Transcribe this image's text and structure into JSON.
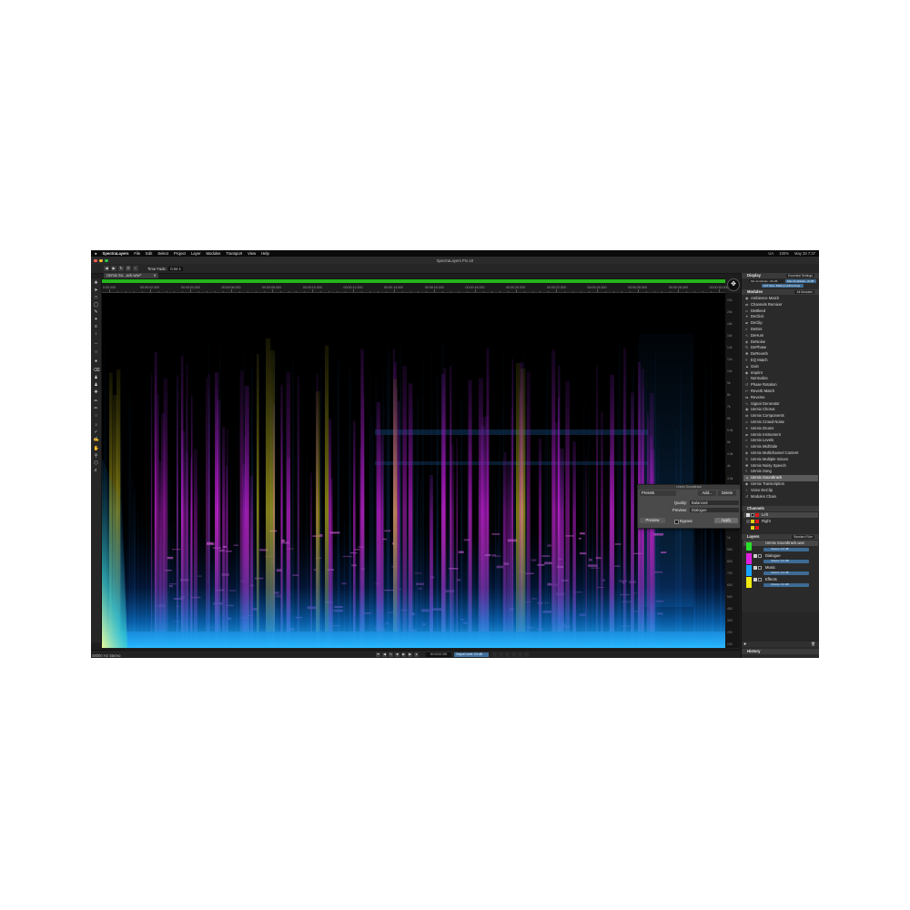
{
  "menubar": {
    "apple": "",
    "app_name": "SpectraLayers",
    "items": [
      "File",
      "Edit",
      "Select",
      "Project",
      "Layer",
      "Modules",
      "Transport",
      "View",
      "Help"
    ],
    "status": [
      "UA",
      "100%",
      "May 28  7:37"
    ]
  },
  "window": {
    "title": "SpectraLayers Pro 10"
  },
  "toolbar": {
    "time_fade_label": "Time Fade:",
    "time_fade_value": "0.04 s"
  },
  "tabs": [
    {
      "label": "Unmix So...ack.wav*"
    }
  ],
  "ruler": {
    "labels": [
      "0:00.000",
      "00:00:02.000",
      "00:00:04.000",
      "00:00:06.000",
      "00:00:08.000",
      "00:00:10.000",
      "00:00:12.000",
      "00:00:14.000",
      "00:00:16.000",
      "00:00:18.000",
      "00:00:20.000",
      "00:00:22.000",
      "00:00:24.000",
      "00:00:26.000",
      "00:00:28.000",
      "00:00:30.000"
    ]
  },
  "freq_axis": {
    "labels": [
      "22k",
      "20k",
      "18k",
      "16k",
      "14k",
      "12k",
      "10k",
      "9k",
      "8k",
      "7k",
      "6k",
      "5.5k",
      "5k",
      "4.5k",
      "4k",
      "3.5k",
      "3k",
      "2.5k",
      "2k",
      "1.5k",
      "1k",
      "900",
      "800",
      "700",
      "600",
      "500",
      "400",
      "300",
      "200",
      "100"
    ]
  },
  "statusbar": {
    "format": "48000 Hz Stereo",
    "timecode": "00:00:00.000",
    "output_level": "Output Level: 0.0 dB"
  },
  "display_panel": {
    "title": "Display",
    "preset": "Essential Settings",
    "controls": [
      "Min Amplitude: -96 dB",
      "Max Amplitude: +6 dB",
      "FFT Size: 8192 px (Ultra Fine)"
    ]
  },
  "modules_panel": {
    "title": "Modules",
    "filter": "All Modules",
    "items": [
      "Ambience Match",
      "Channels Remixer",
      "DeBleed",
      "DeClick",
      "DeClip",
      "DeEss",
      "DeHum",
      "DeNoise",
      "DePhase",
      "DeReverb",
      "EQ Match",
      "Gain",
      "Imprint",
      "Normalize",
      "Phase Rotation",
      "Reverb Match",
      "Reverse",
      "Signal Generator",
      "Unmix Chorus",
      "Unmix Components",
      "Unmix Crowd Noise",
      "Unmix Drums",
      "Unmix Instrument",
      "Unmix Levels",
      "Unmix Mid/Side",
      "Unmix Multichannel Content",
      "Unmix Multiple Voices",
      "Unmix Noisy Speech",
      "Unmix Song",
      "Unmix Soundtrack",
      "Unmix Transcription",
      "Voice DeClip",
      "Modules Chain"
    ],
    "selected": "Unmix Soundtrack"
  },
  "channels_panel": {
    "title": "Channels",
    "items": [
      {
        "label": "Left"
      },
      {
        "label": "Right"
      }
    ]
  },
  "layers_panel": {
    "title": "Layers",
    "view": "Standard Size",
    "parent": "Unmix Soundtrack.wav",
    "parent_volume": "Volume: 0.0 dB",
    "items": [
      {
        "label": "Dialogue",
        "volume": "Volume: 0.0 dB",
        "color": "#e020e0"
      },
      {
        "label": "Music",
        "volume": "Volume: 0.0 dB",
        "color": "#19a3ff"
      },
      {
        "label": "Effects",
        "volume": "Volume: 0.0 dB",
        "color": "#f0ea10"
      }
    ],
    "parent_color": "#2adf2a"
  },
  "history_panel": {
    "title": "History"
  },
  "unmix_dialog": {
    "title": "Unmix Soundtrack",
    "presets_label": "Presets",
    "add_label": "Add...",
    "delete_label": "Delete",
    "quality_label": "Quality:",
    "quality_value": "Balanced",
    "preview_label": "Preview:",
    "preview_value": "Dialogue",
    "preview_button": "Preview",
    "bypass_label": "Bypass",
    "apply_button": "Apply"
  },
  "colors": {
    "accent_green": "#26b31e",
    "dialogue": "#e020e0",
    "music": "#19a3ff",
    "effects": "#f0ea10",
    "app_bg": "#1e1e1e"
  }
}
